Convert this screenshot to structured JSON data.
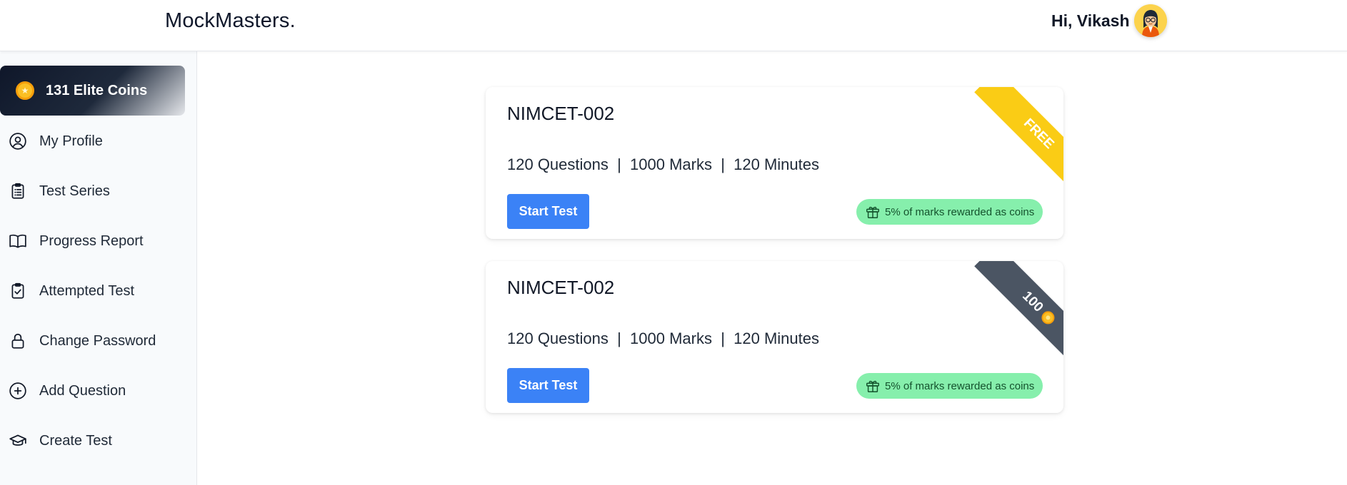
{
  "header": {
    "brand": "MockMasters.",
    "greeting": "Hi, Vikash"
  },
  "sidebar": {
    "coins_label": "131 Elite Coins",
    "items": [
      {
        "label": "My Profile",
        "icon": "user-circle-icon"
      },
      {
        "label": "Test Series",
        "icon": "clipboard-list-icon"
      },
      {
        "label": "Progress Report",
        "icon": "book-open-icon"
      },
      {
        "label": "Attempted Test",
        "icon": "clipboard-check-icon"
      },
      {
        "label": "Change Password",
        "icon": "lock-icon"
      },
      {
        "label": "Add Question",
        "icon": "plus-circle-icon"
      },
      {
        "label": "Create Test",
        "icon": "graduation-cap-icon"
      }
    ]
  },
  "tests": [
    {
      "title": "NIMCET-002",
      "meta": "120 Questions  |  1000 Marks  |  120 Minutes",
      "button": "Start Test",
      "reward": "5% of marks rewarded as coins",
      "ribbon": "FREE"
    },
    {
      "title": "NIMCET-002",
      "meta": "120 Questions  |  1000 Marks  |  120 Minutes",
      "button": "Start Test",
      "reward": "5% of marks rewarded as coins",
      "ribbon": "100"
    }
  ],
  "colors": {
    "primary_button": "#3b82f6",
    "reward_badge": "#86efac",
    "ribbon_free": "#facc15",
    "ribbon_paid": "#4b5563",
    "coin": "#fbbf24"
  }
}
